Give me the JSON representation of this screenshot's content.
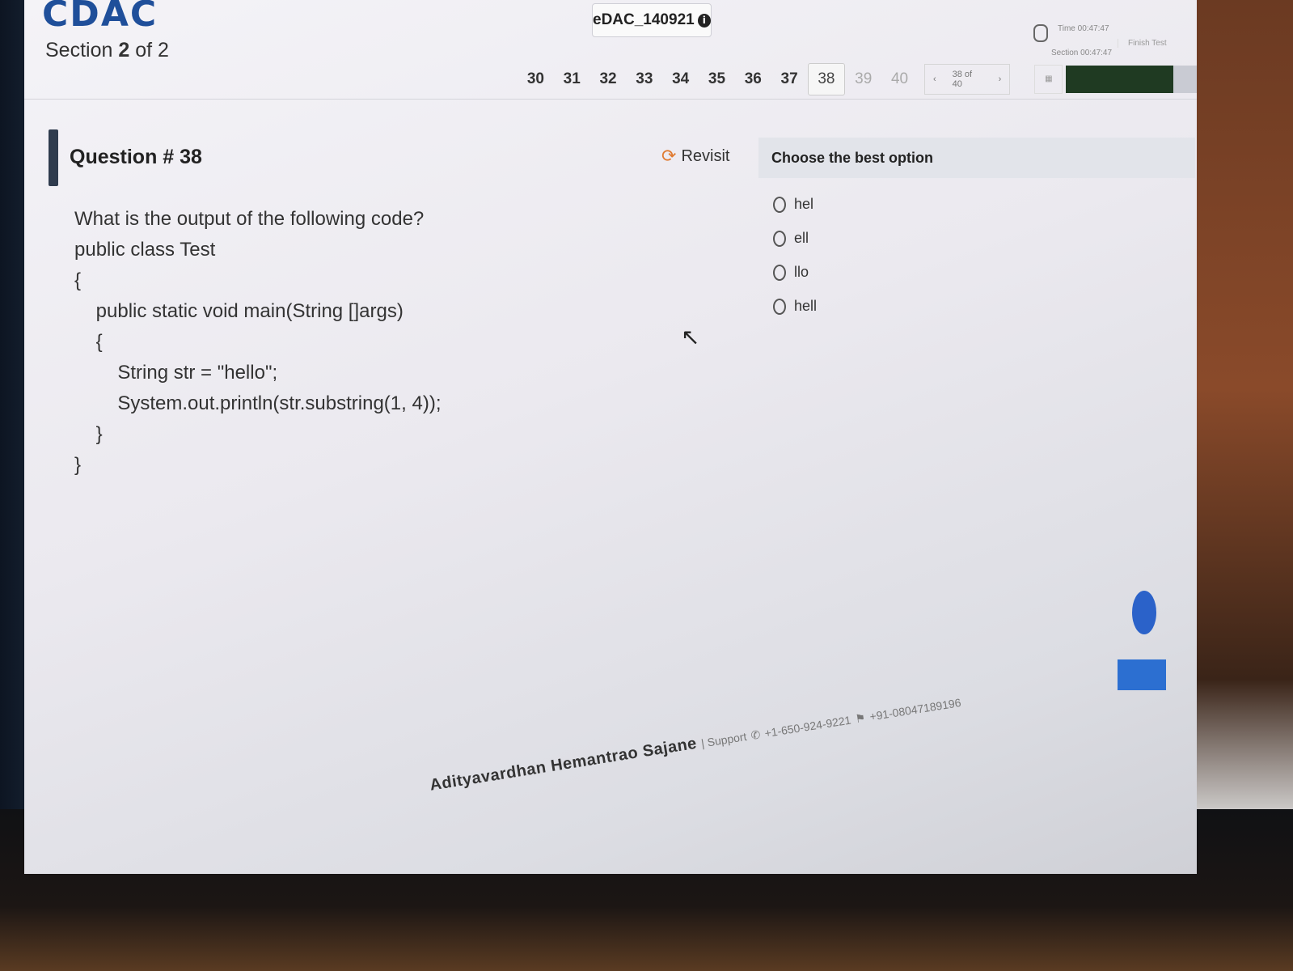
{
  "header": {
    "logo": "CDAC",
    "section_prefix": "Section",
    "section_current": "2",
    "section_suffix": "of 2",
    "exam_id": "eDAC_140921",
    "info_icon": "info-icon",
    "timer_text": "Time 00:47:47",
    "timer_section": "Section 00:47:47",
    "finish_label": "Finish Test"
  },
  "question_nav": {
    "numbers": [
      "30",
      "31",
      "32",
      "33",
      "34",
      "35",
      "36",
      "37",
      "38",
      "39",
      "40"
    ],
    "current": "38",
    "pager_text": "38 of 40",
    "prev_icon": "chevron-left-icon",
    "next_icon": "chevron-right-icon"
  },
  "question": {
    "title": "Question # 38",
    "revisit_label": "Revisit",
    "lines": [
      "What is the output of the following code?",
      "public class Test",
      "{",
      "    public static void main(String []args)",
      "    {",
      "        String str = \"hello\";",
      "        System.out.println(str.substring(1, 4));",
      "    }",
      "}"
    ]
  },
  "options": {
    "heading": "Choose the best option",
    "items": [
      "hel",
      "ell",
      "llo",
      "hell"
    ]
  },
  "footer": {
    "name": "Adityavardhan Hemantrao Sajane",
    "support_label": "| Support",
    "phone_us": "+1-650-924-9221",
    "phone_in": "+91-08047189196"
  }
}
